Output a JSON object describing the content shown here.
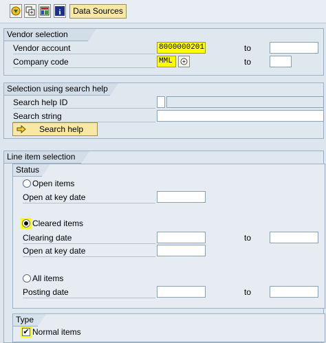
{
  "toolbar": {
    "data_sources_label": "Data Sources"
  },
  "vendor_selection": {
    "title": "Vendor selection",
    "vendor_account_label": "Vendor account",
    "vendor_account_value": "8000000201",
    "vendor_account_to_label": "to",
    "company_code_label": "Company code",
    "company_code_value": "MML",
    "company_code_to_label": "to"
  },
  "search_help": {
    "title": "Selection using search help",
    "id_label": "Search help ID",
    "string_label": "Search string",
    "button_label": "Search help"
  },
  "line_items": {
    "title": "Line item selection",
    "status": {
      "title": "Status",
      "open_items_label": "Open items",
      "open_key_date_label": "Open at key date",
      "cleared_items_label": "Cleared items",
      "clearing_date_label": "Clearing date",
      "clearing_to_label": "to",
      "cleared_key_date_label": "Open at key date",
      "all_items_label": "All items",
      "posting_date_label": "Posting date",
      "posting_to_label": "to"
    },
    "type": {
      "title": "Type",
      "normal_items_label": "Normal items"
    }
  },
  "colors": {
    "highlight": "#ffff00",
    "button_yellow": "#f7e8a4",
    "group_bg": "#dfe7ef"
  }
}
